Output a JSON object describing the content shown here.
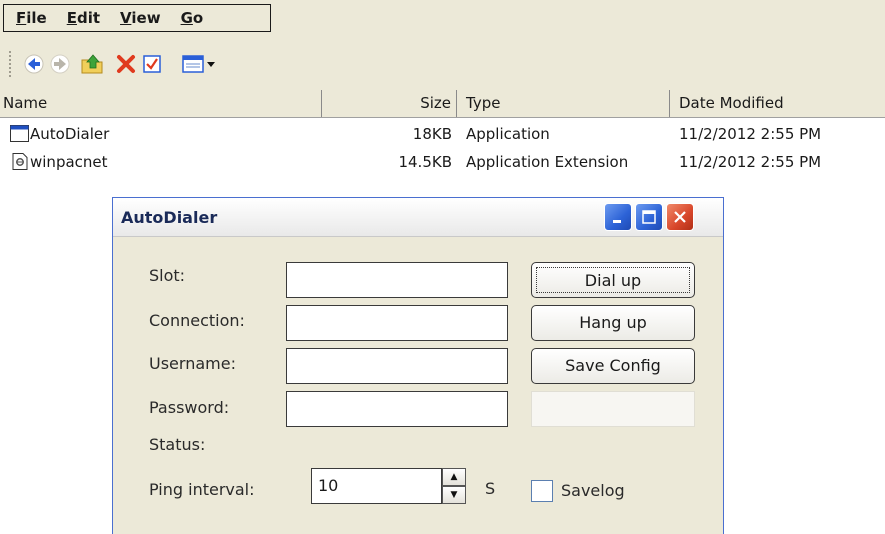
{
  "menubar": {
    "items": [
      {
        "pre": "",
        "u": "F",
        "post": "ile"
      },
      {
        "pre": "",
        "u": "E",
        "post": "dit"
      },
      {
        "pre": "",
        "u": "V",
        "post": "iew"
      },
      {
        "pre": "",
        "u": "G",
        "post": "o"
      }
    ]
  },
  "toolbar": {
    "buttons": [
      "back-icon",
      "forward-icon",
      "up-folder-icon",
      "delete-icon",
      "properties-icon",
      "view-menu-icon"
    ]
  },
  "list": {
    "columns": {
      "name": "Name",
      "size": "Size",
      "type": "Type",
      "date": "Date Modified"
    },
    "rows": [
      {
        "name": "AutoDialer",
        "size": "18KB",
        "type": "Application",
        "date": "11/2/2012 2:55 PM",
        "icon": "application-icon"
      },
      {
        "name": "winpacnet",
        "size": "14.5KB",
        "type": "Application Extension",
        "date": "11/2/2012 2:55 PM",
        "icon": "dll-file-icon"
      }
    ]
  },
  "dialog": {
    "title": "AutoDialer",
    "labels": {
      "slot": "Slot:",
      "connection": "Connection:",
      "username": "Username:",
      "password": "Password:",
      "status": "Status:",
      "ping_interval": "Ping interval:",
      "seconds_unit": "S"
    },
    "fields": {
      "slot": "",
      "connection": "",
      "username": "",
      "password": "",
      "ping_interval": "10"
    },
    "buttons": {
      "dial_up": "Dial up",
      "hang_up": "Hang up",
      "save_config": "Save Config"
    },
    "savelog": {
      "label": "Savelog",
      "checked": false
    }
  }
}
